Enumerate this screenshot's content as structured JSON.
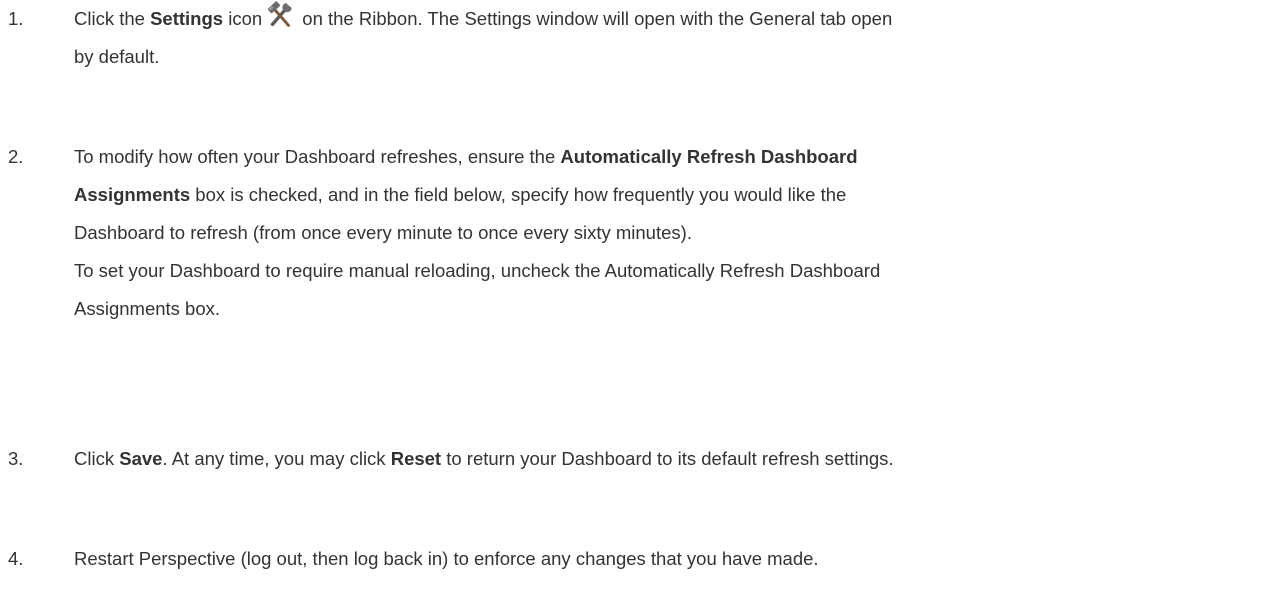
{
  "steps": [
    {
      "number": "1.",
      "line1_a": "Click the ",
      "line1_bold": "Settings",
      "line1_b": " icon",
      "icon": "hammer-wrench-icon",
      "line1_c": " on the Ribbon. The Settings window will open with the General tab open",
      "line2": "by default."
    },
    {
      "number": "2.",
      "line1_a": "To modify how often your Dashboard refreshes, ensure the ",
      "line1_bold": "Automatically Refresh Dashboard",
      "line2_bold": "Assignments",
      "line2_a": " box is checked, and in the field below, specify how frequently you would like the",
      "line3": "Dashboard to refresh (from once every minute to once every sixty minutes).",
      "line4": "To set your Dashboard to require manual reloading, uncheck the Automatically Refresh Dashboard",
      "line5": "Assignments box."
    },
    {
      "number": "3.",
      "part_a": "Click ",
      "bold_save": "Save",
      "part_b": ". At any time, you may click ",
      "bold_reset": "Reset",
      "part_c": " to return your Dashboard to its default refresh settings."
    },
    {
      "number": "4.",
      "text": "Restart Perspective (log out, then log back in) to enforce any changes that you have made."
    }
  ]
}
